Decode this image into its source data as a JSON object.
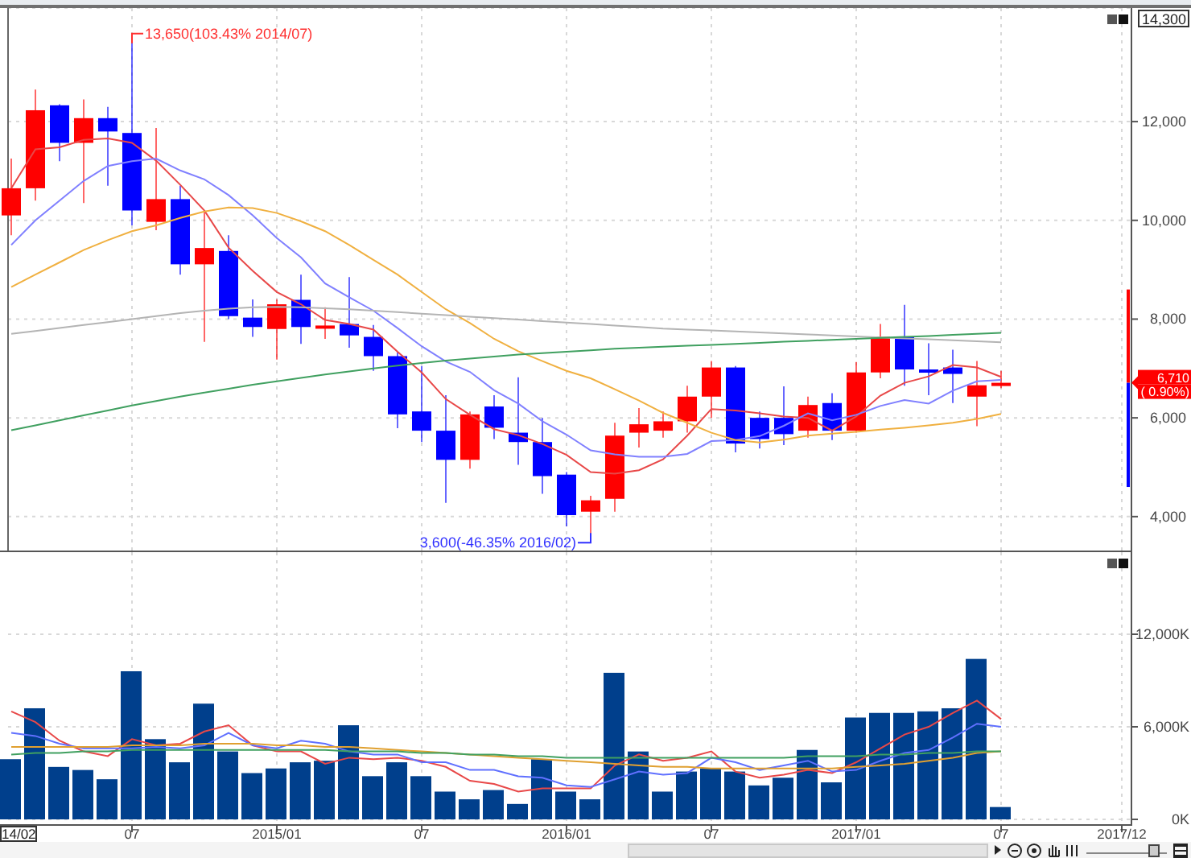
{
  "price_chart": {
    "chart_data": {
      "type": "candlestick",
      "grid": true,
      "ylim": [
        3280,
        14300
      ],
      "yticks": [
        {
          "value": 14300,
          "label": "14,300"
        },
        {
          "value": 12000,
          "label": "12,000"
        },
        {
          "value": 10000,
          "label": "10,000"
        },
        {
          "value": 8000,
          "label": "8,000"
        },
        {
          "value": 6000,
          "label": "6,000"
        },
        {
          "value": 4000,
          "label": "4,000"
        }
      ],
      "categories": [
        null,
        null,
        null,
        null,
        null,
        null,
        null,
        null,
        null,
        null,
        null,
        null,
        null,
        null,
        null,
        null,
        null,
        null,
        null,
        null,
        null,
        null,
        null,
        null,
        null,
        null,
        null,
        null,
        null,
        null,
        null,
        null,
        null,
        null,
        null,
        null,
        null,
        null,
        null,
        null,
        null,
        null
      ],
      "ohlc": [
        [
          10100,
          11250,
          9700,
          10650
        ],
        [
          10650,
          12650,
          10400,
          12230
        ],
        [
          12330,
          12350,
          11200,
          11570
        ],
        [
          11570,
          12450,
          10350,
          12070
        ],
        [
          12070,
          12300,
          10700,
          11800
        ],
        [
          11770,
          13650,
          9900,
          10200
        ],
        [
          9970,
          11870,
          9800,
          10430
        ],
        [
          10430,
          10700,
          8900,
          9110
        ],
        [
          9110,
          10200,
          7540,
          9440
        ],
        [
          9380,
          9700,
          8000,
          8060
        ],
        [
          8030,
          8400,
          7640,
          7840
        ],
        [
          7800,
          8400,
          7180,
          8300
        ],
        [
          8390,
          8900,
          7500,
          7840
        ],
        [
          7840,
          8240,
          7600,
          7870
        ],
        [
          7900,
          8850,
          7420,
          7670
        ],
        [
          7640,
          7880,
          6950,
          7250
        ],
        [
          7250,
          7330,
          5790,
          6070
        ],
        [
          6130,
          7050,
          5510,
          5740
        ],
        [
          5740,
          6460,
          4280,
          5150
        ],
        [
          5150,
          6130,
          4970,
          6070
        ],
        [
          6230,
          6460,
          5570,
          5800
        ],
        [
          5700,
          6820,
          5050,
          5510
        ],
        [
          5510,
          6000,
          4460,
          4820
        ],
        [
          4850,
          4900,
          3800,
          4030
        ],
        [
          4100,
          4420,
          3600,
          4330
        ],
        [
          4360,
          5900,
          4100,
          5640
        ],
        [
          5700,
          6200,
          5400,
          5870
        ],
        [
          5740,
          6130,
          5600,
          5930
        ],
        [
          5930,
          6650,
          5700,
          6430
        ],
        [
          6430,
          7150,
          6000,
          7020
        ],
        [
          7020,
          7050,
          5300,
          5480
        ],
        [
          6000,
          6130,
          5380,
          5570
        ],
        [
          6000,
          6640,
          5450,
          5670
        ],
        [
          5740,
          6430,
          5600,
          6260
        ],
        [
          6300,
          6500,
          5550,
          5740
        ],
        [
          5740,
          7130,
          5700,
          6920
        ],
        [
          6920,
          7900,
          6800,
          7640
        ],
        [
          7640,
          8290,
          6650,
          6980
        ],
        [
          6980,
          7510,
          6460,
          6920
        ],
        [
          7020,
          7380,
          6300,
          6890
        ],
        [
          6430,
          7150,
          5830,
          6660
        ],
        [
          6650,
          6950,
          6600,
          6710
        ]
      ],
      "series": [
        {
          "type": "line",
          "color": "#e84848",
          "values": [
            10650,
            11440,
            11480,
            11630,
            11660,
            11570,
            11210,
            10720,
            10200,
            9450,
            8980,
            8550,
            8300,
            7980,
            7900,
            7790,
            7340,
            6920,
            6380,
            6060,
            5770,
            5650,
            5470,
            5250,
            4900,
            4870,
            4940,
            5160,
            5640,
            6180,
            6150,
            6090,
            6030,
            6000,
            5740,
            6030,
            6450,
            6710,
            6840,
            7070,
            7020,
            6830
          ]
        },
        {
          "type": "line",
          "color": "#8080ff",
          "values": [
            9500,
            10000,
            10400,
            10800,
            11100,
            11200,
            11250,
            11010,
            10830,
            10510,
            10100,
            9640,
            9250,
            8720,
            8440,
            8170,
            7820,
            7450,
            7140,
            6930,
            6560,
            6290,
            5930,
            5660,
            5340,
            5260,
            5210,
            5210,
            5270,
            5530,
            5550,
            5630,
            5840,
            6090,
            5950,
            6060,
            6240,
            6360,
            6290,
            6550,
            6740,
            6770
          ]
        },
        {
          "type": "line",
          "color": "#f0b040",
          "values": [
            8650,
            8900,
            9150,
            9400,
            9600,
            9780,
            9900,
            10050,
            10180,
            10260,
            10250,
            10150,
            9980,
            9780,
            9500,
            9200,
            8900,
            8550,
            8200,
            7920,
            7600,
            7350,
            7150,
            6950,
            6800,
            6580,
            6350,
            6100,
            5900,
            5700,
            5550,
            5500,
            5560,
            5640,
            5680,
            5720,
            5760,
            5800,
            5850,
            5900,
            5980,
            6080
          ]
        },
        {
          "type": "line",
          "color": "#b4b4b4",
          "values": [
            7700,
            7760,
            7820,
            7880,
            7940,
            8000,
            8060,
            8120,
            8170,
            8210,
            8240,
            8250,
            8240,
            8220,
            8200,
            8170,
            8140,
            8110,
            8080,
            8050,
            8020,
            7990,
            7960,
            7930,
            7900,
            7870,
            7840,
            7810,
            7790,
            7770,
            7750,
            7730,
            7710,
            7690,
            7670,
            7650,
            7630,
            7610,
            7590,
            7570,
            7550,
            7530
          ]
        },
        {
          "type": "line",
          "color": "#40a060",
          "values": [
            5750,
            5850,
            5950,
            6050,
            6150,
            6250,
            6340,
            6430,
            6510,
            6590,
            6670,
            6740,
            6810,
            6880,
            6940,
            7000,
            7060,
            7110,
            7160,
            7200,
            7240,
            7280,
            7310,
            7340,
            7370,
            7400,
            7420,
            7440,
            7460,
            7480,
            7500,
            7520,
            7540,
            7560,
            7580,
            7600,
            7620,
            7640,
            7660,
            7680,
            7700,
            7720
          ]
        }
      ],
      "annotations": [
        {
          "text": "13,650(103.43% 2014/07)"
        },
        {
          "text": "3,600(-46.35% 2016/02)"
        }
      ]
    },
    "last_price": {
      "price": "6,710",
      "change": "( 0.90%)"
    }
  },
  "volume_chart": {
    "chart_data": {
      "type": "bar",
      "grid": true,
      "ylim": [
        0,
        17320
      ],
      "yticks": [
        {
          "value": 0,
          "label": "0K"
        },
        {
          "value": 6000,
          "label": "6,000K"
        },
        {
          "value": 12000,
          "label": "12,000K"
        }
      ],
      "categories": [
        "14/02",
        null,
        null,
        null,
        null,
        "07",
        null,
        null,
        null,
        null,
        null,
        "2015/01",
        null,
        null,
        null,
        null,
        null,
        "07",
        null,
        null,
        null,
        null,
        null,
        "2016/01",
        null,
        null,
        null,
        null,
        null,
        "07",
        null,
        null,
        null,
        null,
        null,
        "2017/01",
        null,
        null,
        null,
        null,
        null,
        "07",
        null,
        null,
        null,
        null,
        "2017/12"
      ],
      "series": [
        {
          "color": "#003f8c",
          "values": [
            3900,
            7200,
            3400,
            3200,
            2600,
            9600,
            5200,
            3700,
            7500,
            4400,
            3000,
            3300,
            3700,
            3800,
            6100,
            2800,
            3700,
            2800,
            1800,
            1300,
            1900,
            1000,
            3900,
            1800,
            1300,
            9500,
            4400,
            1800,
            3100,
            3300,
            3100,
            2200,
            2700,
            4500,
            2400,
            6600,
            6900,
            6900,
            7000,
            7200,
            10400,
            800,
            null,
            null,
            null,
            null,
            null
          ]
        },
        {
          "type": "line",
          "color": "#e84848",
          "values": [
            7000,
            6300,
            5100,
            4400,
            4100,
            5200,
            4800,
            4900,
            5700,
            6100,
            4800,
            4400,
            4400,
            3600,
            4000,
            3900,
            4000,
            3800,
            3400,
            2500,
            2300,
            1800,
            2000,
            2000,
            2000,
            3500,
            4200,
            3800,
            4000,
            4400,
            3100,
            2700,
            2900,
            3200,
            3000,
            3700,
            4600,
            5500,
            6000,
            6900,
            7700,
            6500,
            null,
            null,
            null,
            null,
            null
          ]
        },
        {
          "type": "line",
          "color": "#6070ff",
          "values": [
            5600,
            5400,
            4900,
            4600,
            4600,
            4600,
            4700,
            4600,
            4800,
            5600,
            4800,
            4600,
            5100,
            4900,
            4400,
            4200,
            4200,
            3700,
            3700,
            3200,
            3200,
            2800,
            2700,
            2200,
            2100,
            2600,
            3100,
            2900,
            3000,
            4000,
            3700,
            3200,
            3500,
            3800,
            3100,
            3200,
            3800,
            4300,
            4500,
            5300,
            6200,
            6000,
            null,
            null,
            null,
            null,
            null
          ]
        },
        {
          "type": "line",
          "color": "#e0a030",
          "values": [
            4700,
            4700,
            4700,
            4700,
            4700,
            4800,
            4800,
            4800,
            4900,
            4900,
            4900,
            4800,
            4800,
            4700,
            4700,
            4600,
            4500,
            4400,
            4300,
            4200,
            4100,
            4000,
            3900,
            3800,
            3700,
            3600,
            3500,
            3400,
            3400,
            3300,
            3300,
            3300,
            3300,
            3300,
            3300,
            3400,
            3500,
            3600,
            3800,
            4000,
            4300,
            4400,
            null,
            null,
            null,
            null,
            null
          ]
        },
        {
          "type": "line",
          "color": "#40a060",
          "values": [
            4200,
            4300,
            4300,
            4400,
            4400,
            4500,
            4500,
            4500,
            4500,
            4500,
            4500,
            4500,
            4500,
            4500,
            4400,
            4400,
            4400,
            4300,
            4300,
            4200,
            4200,
            4100,
            4100,
            4000,
            4000,
            4000,
            4000,
            4000,
            4000,
            4000,
            4000,
            4000,
            4000,
            4100,
            4100,
            4100,
            4200,
            4200,
            4300,
            4300,
            4400,
            4400,
            null,
            null,
            null,
            null,
            null
          ]
        }
      ]
    }
  }
}
